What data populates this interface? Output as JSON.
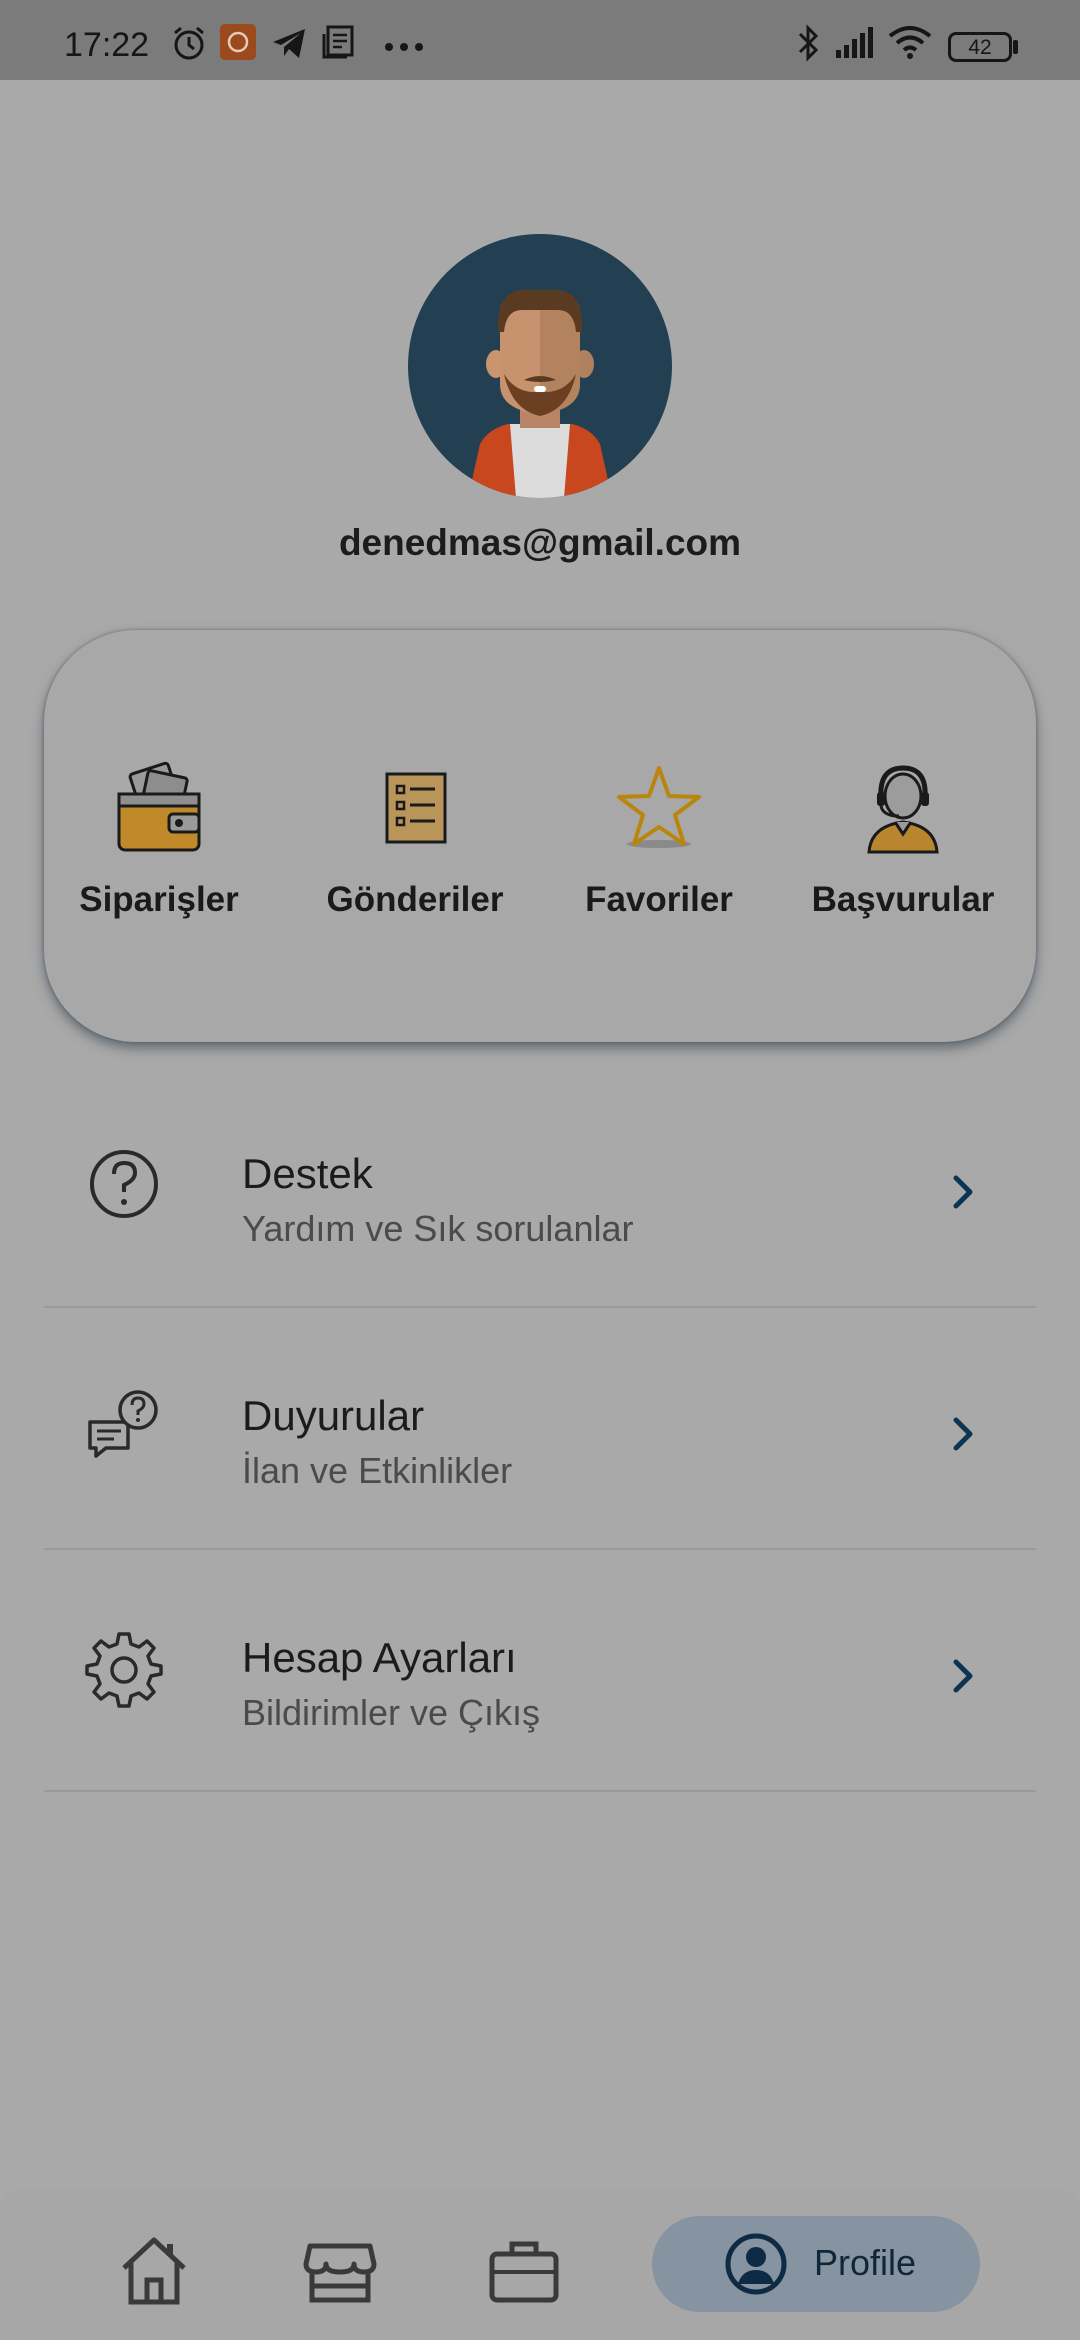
{
  "status_bar": {
    "time": "17:22",
    "battery": "42",
    "icons": [
      "alarm-icon",
      "app-notification-icon",
      "telegram-icon",
      "news-icon",
      "more-dots-icon",
      "bluetooth-icon",
      "signal-icon",
      "wifi-icon",
      "battery-icon"
    ]
  },
  "profile": {
    "email": "denedmas@gmail.com",
    "avatar_icon": "user-avatar-icon"
  },
  "quick_actions": [
    {
      "label": "Siparişler",
      "icon": "wallet-icon"
    },
    {
      "label": "Gönderiler",
      "icon": "list-icon"
    },
    {
      "label": "Favoriler",
      "icon": "star-icon"
    },
    {
      "label": "Başvurular",
      "icon": "support-agent-icon"
    }
  ],
  "menu": [
    {
      "title": "Destek",
      "subtitle": "Yardım ve Sık sorulanlar",
      "icon": "question-circle-icon"
    },
    {
      "title": "Duyurular",
      "subtitle": "İlan ve Etkinlikler",
      "icon": "chat-question-icon"
    },
    {
      "title": "Hesap Ayarları",
      "subtitle": "Bildirimler ve Çıkış",
      "icon": "gear-icon"
    }
  ],
  "bottom_nav": {
    "items": [
      "home-icon",
      "store-icon",
      "briefcase-icon",
      "profile-icon"
    ],
    "active_label": "Profile"
  },
  "colors": {
    "accent": "#0d3453",
    "avatar_bg": "#233f52",
    "overlay_bg": "#a9a9a9"
  }
}
